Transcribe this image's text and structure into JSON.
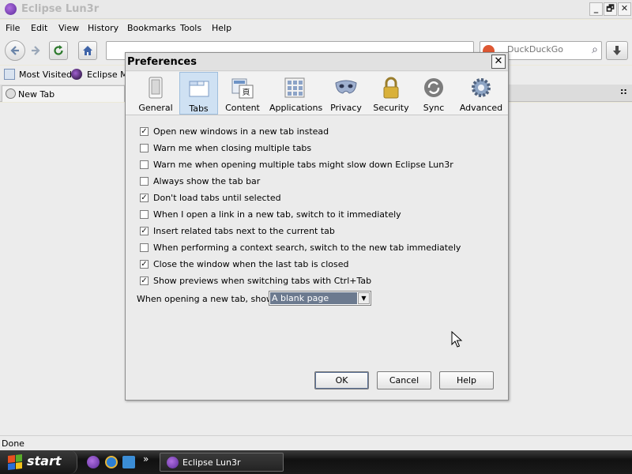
{
  "window": {
    "title": "Eclipse Lun3r",
    "minimize_label": "_",
    "restore_label": "🗗",
    "close_label": "✕"
  },
  "menu": [
    "File",
    "Edit",
    "View",
    "History",
    "Bookmarks",
    "Tools",
    "Help"
  ],
  "navbar": {
    "back_icon": "back-arrow-icon",
    "forward_icon": "forward-arrow-icon",
    "reload_icon": "reload-icon",
    "home_icon": "home-icon",
    "search_placeholder": "DuckDuckGo",
    "download_icon": "download-icon"
  },
  "bookmarks": {
    "most_visited": "Most Visited",
    "eclipse": "Eclipse Ma"
  },
  "tab": {
    "label": "New Tab",
    "list_icon": "::"
  },
  "status": "Done",
  "taskbar": {
    "start_label": "start",
    "chevron": "»",
    "task_label": "Eclipse Lun3r"
  },
  "dialog": {
    "title": "Preferences",
    "close_label": "✕",
    "panes": [
      {
        "label": "General",
        "icon": "general-switch-icon",
        "selected": false
      },
      {
        "label": "Tabs",
        "icon": "tabs-window-icon",
        "selected": true
      },
      {
        "label": "Content",
        "icon": "content-page-icon",
        "selected": false
      },
      {
        "label": "Applications",
        "icon": "applications-grid-icon",
        "selected": false
      },
      {
        "label": "Privacy",
        "icon": "privacy-mask-icon",
        "selected": false
      },
      {
        "label": "Security",
        "icon": "security-padlock-icon",
        "selected": false
      },
      {
        "label": "Sync",
        "icon": "sync-arrows-icon",
        "selected": false
      },
      {
        "label": "Advanced",
        "icon": "advanced-gear-icon",
        "selected": false
      }
    ],
    "options": [
      {
        "label": "Open new windows in a new tab instead",
        "checked": true
      },
      {
        "label": "Warn me when closing multiple tabs",
        "checked": false
      },
      {
        "label": "Warn me when opening multiple tabs might slow down Eclipse Lun3r",
        "checked": false
      },
      {
        "label": "Always show the tab bar",
        "checked": false
      },
      {
        "label": "Don't load tabs until selected",
        "checked": true
      },
      {
        "label": "When I open a link in a new tab, switch to it immediately",
        "checked": false
      },
      {
        "label": "Insert related tabs next to the current tab",
        "checked": true
      },
      {
        "label": "When performing a context search, switch to the new tab immediately",
        "checked": false
      },
      {
        "label": "Close the window when the last tab is closed",
        "checked": true
      },
      {
        "label": "Show previews when switching tabs with Ctrl+Tab",
        "checked": true
      }
    ],
    "new_tab_label": "When opening a new tab, show:",
    "new_tab_value": "A blank page",
    "buttons": {
      "ok": "OK",
      "cancel": "Cancel",
      "help": "Help"
    }
  },
  "colors": {
    "selected_pane": "#cfe1f3",
    "taskbar": "#1a1a1a",
    "select_highlight": "#6c7a8f"
  }
}
